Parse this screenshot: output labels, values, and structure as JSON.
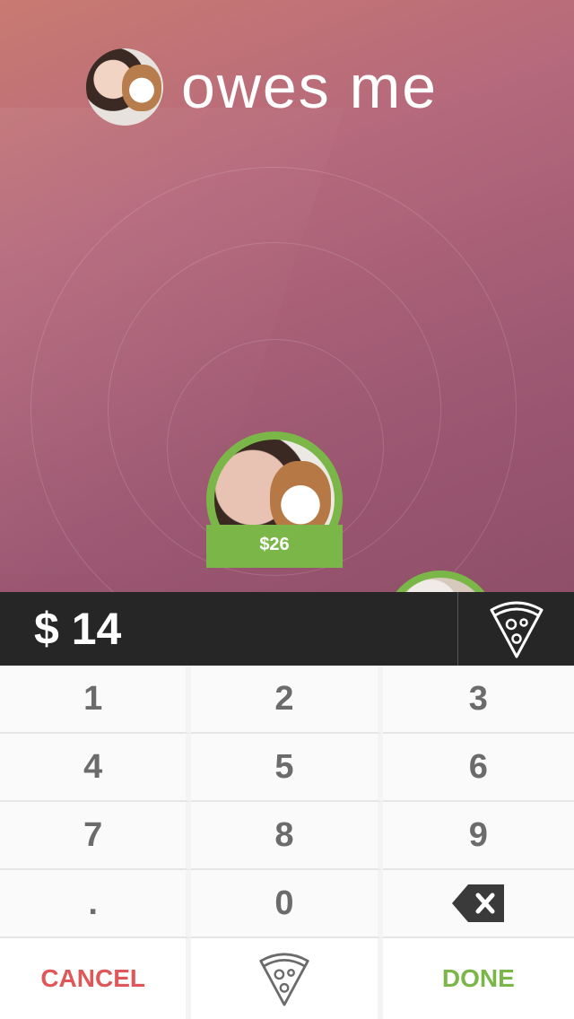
{
  "header": {
    "title": "owes me"
  },
  "bubbles": [
    {
      "amount": "$26"
    }
  ],
  "amount_bar": {
    "currency": "$",
    "value": "14",
    "display": "$ 14"
  },
  "keypad": {
    "keys": [
      "1",
      "2",
      "3",
      "4",
      "5",
      "6",
      "7",
      "8",
      "9",
      ".",
      "0"
    ],
    "backspace_icon": "backspace-icon"
  },
  "actions": {
    "cancel_label": "CANCEL",
    "done_label": "DONE",
    "pizza_icon": "pizza-slice-icon"
  },
  "colors": {
    "accent_green": "#7ab648",
    "cancel_red": "#e0575a",
    "bar_dark": "#262626"
  }
}
